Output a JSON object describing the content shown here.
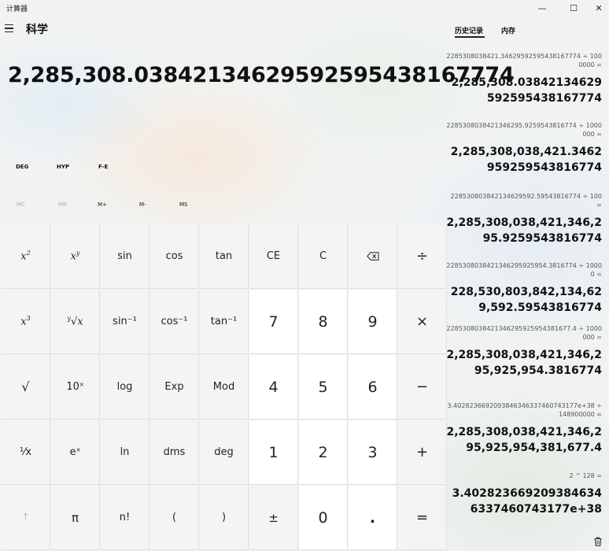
{
  "app_title": "计算器",
  "window": {
    "minimize_glyph": "—",
    "maximize_glyph": "☐",
    "close_glyph": "✕"
  },
  "mode": {
    "title": "科学"
  },
  "display": {
    "value": "2,285,308.03842134629592595438167774"
  },
  "angle": {
    "deg": "DEG",
    "hyp": "HYP",
    "fe": "F-E"
  },
  "memory": {
    "mc": "MC",
    "mr": "MR",
    "mplus": "M+",
    "mminus": "M-",
    "ms": "MS"
  },
  "keys": {
    "row1": [
      "sin",
      "cos",
      "tan",
      "CE",
      "C"
    ],
    "row2": [
      "sin⁻¹",
      "cos⁻¹",
      "tan⁻¹",
      "7",
      "8",
      "9",
      "×"
    ],
    "row3": [
      "√",
      "10ˣ",
      "log",
      "Exp",
      "Mod",
      "4",
      "5",
      "6",
      "−"
    ],
    "row4": [
      "¹⁄x",
      "eˣ",
      "ln",
      "dms",
      "deg",
      "1",
      "2",
      "3",
      "+"
    ],
    "row5": [
      "↑",
      "π",
      "n!",
      "(",
      ")",
      "±",
      "0",
      ".",
      "="
    ],
    "divide": "÷"
  },
  "panel": {
    "history_tab": "历史记录",
    "memory_tab": "内存"
  },
  "history": [
    {
      "expr": "2285308038421.34629592595438167774  ÷  1000000 =",
      "result": "2,285,308.03842134629592595438167774"
    },
    {
      "expr": "2285308038421346295.9259543816774  ÷  1000000 =",
      "result": "2,285,308,038,421.3462959259543816774"
    },
    {
      "expr": "228530803842134629592.59543816774  ÷  100 =",
      "result": "2,285,308,038,421,346,295.9259543816774"
    },
    {
      "expr": "2285308038421346295925954.3816774  ÷  10000 =",
      "result": "228,530,803,842,134,629,592.59543816774"
    },
    {
      "expr": "2285308038421346295925954381677.4  ÷  1000000 =",
      "result": "2,285,308,038,421,346,295,925,954.3816774"
    },
    {
      "expr": "3.4028236692093846346337460743177e+38  ÷  148900000 =",
      "result": "2,285,308,038,421,346,295,925,954,381,677.4"
    },
    {
      "expr": "2  ^  128 =",
      "result": "3.4028236692093846346337460743177e+38"
    }
  ]
}
